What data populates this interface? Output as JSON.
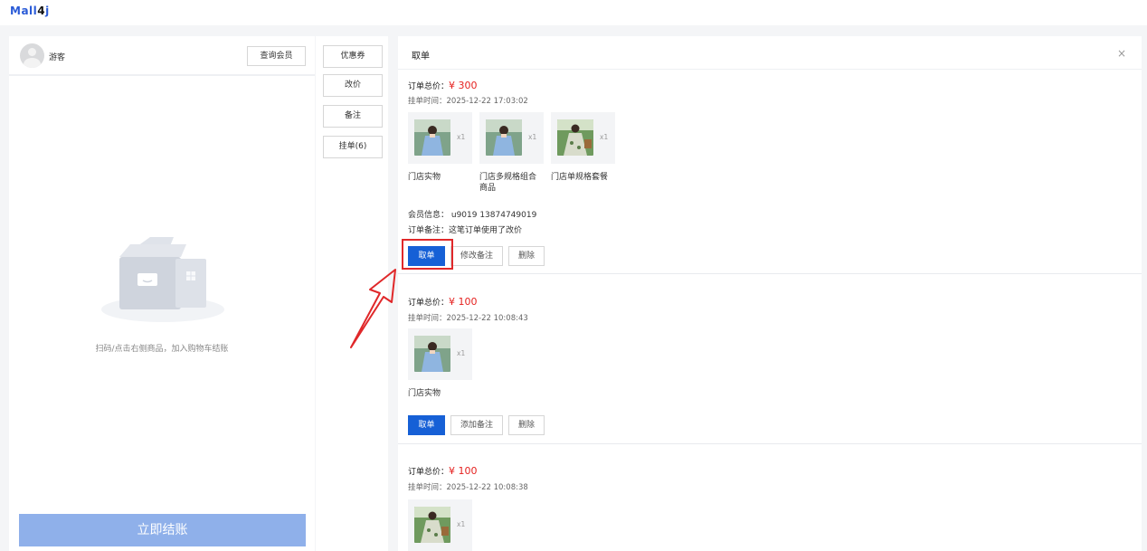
{
  "header": {
    "logo_main": "Mall",
    "logo_four": "4",
    "logo_j": "j"
  },
  "left": {
    "guest_name": "游客",
    "query_member_label": "查询会员",
    "empty_text": "扫码/点击右侧商品，加入购物车结账",
    "checkout_label": "立即结账"
  },
  "middle": {
    "buttons": [
      "优惠券",
      "改价",
      "备注",
      "挂单(6)"
    ]
  },
  "panel": {
    "title": "取单",
    "close": "×"
  },
  "orders": [
    {
      "total_label": "订单总价：",
      "total_value": "¥ 300",
      "time": "挂单时间：2025-12-22 17:03:02",
      "items": [
        {
          "name": "门店实物",
          "qty": "x1"
        },
        {
          "name": "门店多规格组合商品",
          "qty": "x1"
        },
        {
          "name": "门店单规格套餐",
          "qty": "x1"
        }
      ],
      "member": "会员信息：  u9019  13874749019",
      "remark": "订单备注：这笔订单使用了改价",
      "buttons": [
        "取单",
        "修改备注",
        "删除"
      ]
    },
    {
      "total_label": "订单总价：",
      "total_value": "¥ 100",
      "time": "挂单时间：2025-12-22 10:08:43",
      "items": [
        {
          "name": "门店实物",
          "qty": "x1"
        }
      ],
      "buttons": [
        "取单",
        "添加备注",
        "删除"
      ]
    },
    {
      "total_label": "订单总价：",
      "total_value": "¥ 100",
      "time": "挂单时间：2025-12-22 10:08:38",
      "items": [
        {
          "name": "",
          "qty": "x1"
        }
      ]
    }
  ],
  "colors": {
    "primary": "#1660d6",
    "price": "#e5211f",
    "checkout_disabled": "#8fb0ea",
    "highlight": "#e0282a"
  }
}
